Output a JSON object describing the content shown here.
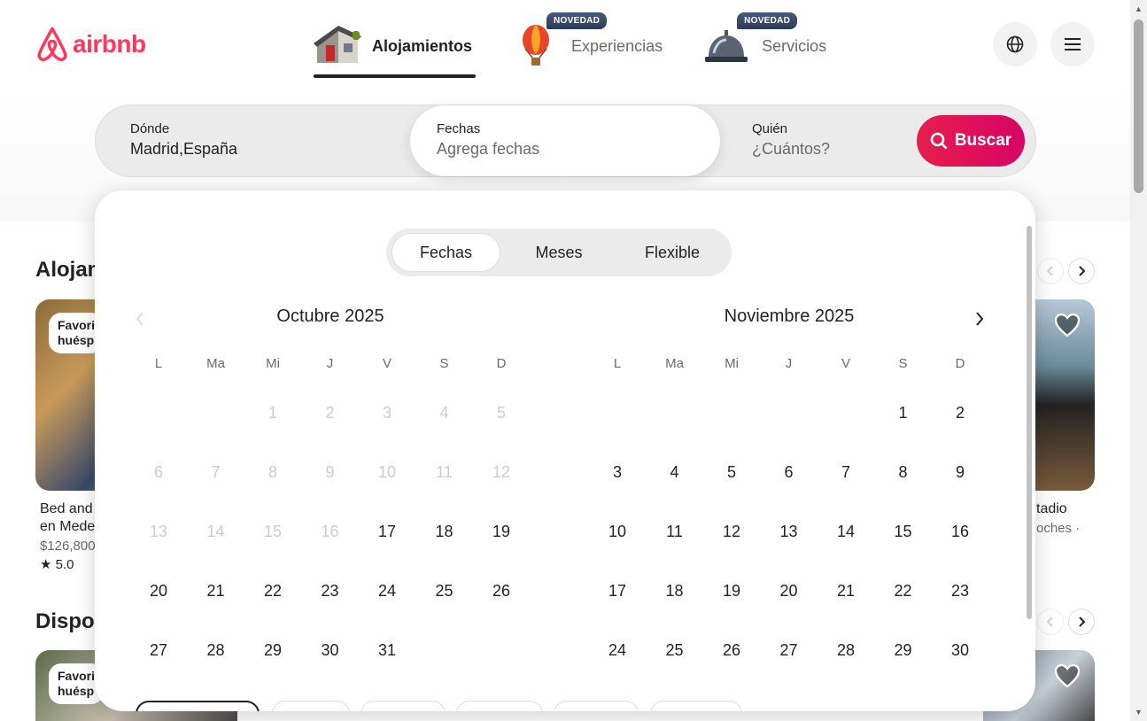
{
  "brand": {
    "name": "airbnb",
    "color": "#ff385c"
  },
  "nav": {
    "tabs": [
      {
        "label": "Alojamientos",
        "active": true,
        "badge": "",
        "icon": "house-icon"
      },
      {
        "label": "Experiencias",
        "active": false,
        "badge": "NOVEDAD",
        "icon": "hot-air-balloon-icon"
      },
      {
        "label": "Servicios",
        "active": false,
        "badge": "NOVEDAD",
        "icon": "service-bell-icon"
      }
    ]
  },
  "search": {
    "where_label": "Dónde",
    "where_value": "Madrid,España",
    "dates_label": "Fechas",
    "dates_placeholder": "Agrega fechas",
    "who_label": "Quién",
    "who_placeholder": "¿Cuántos?",
    "button_label": "Buscar"
  },
  "background": {
    "section1_title": "Alojam",
    "section2_title": "Dispor",
    "fav_line1": "Favori",
    "fav_line2": "huésp",
    "listing1_title_line1": "Bed and",
    "listing1_title_line2": "en Mede",
    "listing1_price": "$126,800",
    "listing1_rating": "★ 5.0",
    "listing_right_title": "tadio",
    "listing_right_sub": "oches ·"
  },
  "calendar": {
    "modes": [
      "Fechas",
      "Meses",
      "Flexible"
    ],
    "active_mode": "Fechas",
    "weekdays": [
      "L",
      "Ma",
      "Mi",
      "J",
      "V",
      "S",
      "D"
    ],
    "months": [
      {
        "title": "Octubre 2025",
        "first_weekday_index": 2,
        "days": 31,
        "disabled_through": 16
      },
      {
        "title": "Noviembre 2025",
        "first_weekday_index": 5,
        "days": 30,
        "disabled_through": 0
      }
    ]
  }
}
